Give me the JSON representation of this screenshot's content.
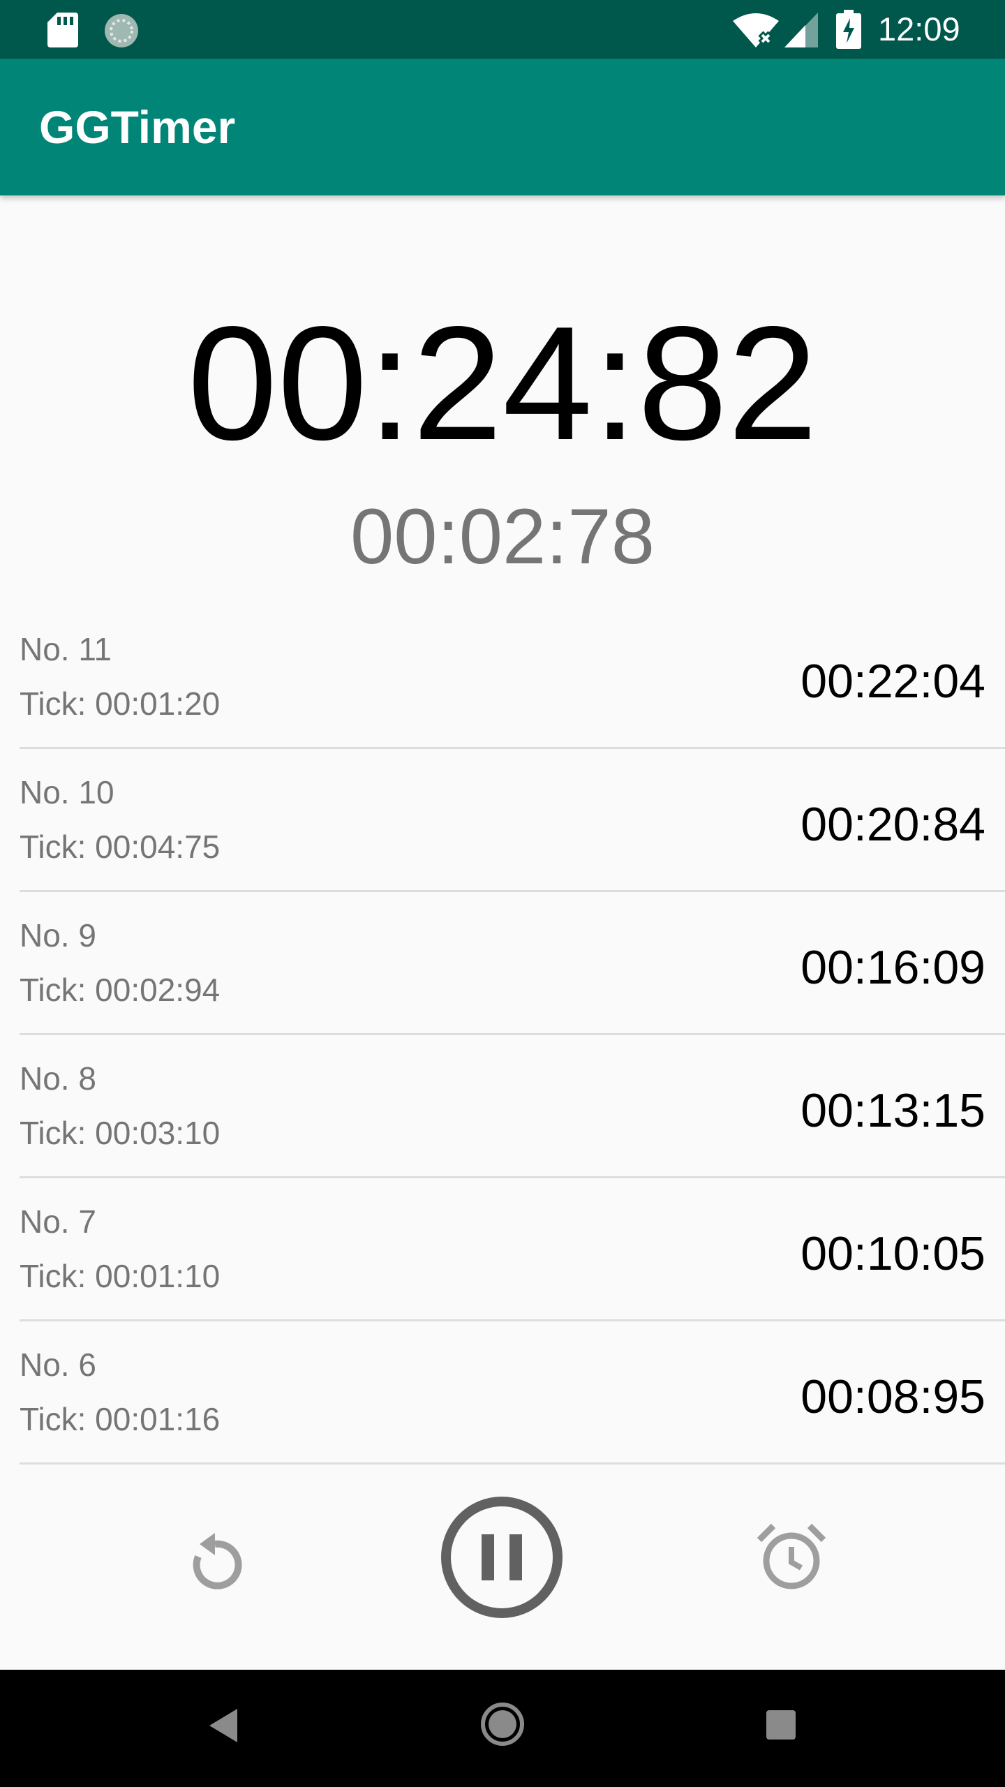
{
  "status_bar": {
    "time": "12:09",
    "icons": [
      "sd-card-icon",
      "sync-icon",
      "wifi-off-icon",
      "cell-signal-icon",
      "battery-charging-icon"
    ]
  },
  "app_bar": {
    "title": "GGTimer",
    "color": "#008577"
  },
  "timer": {
    "total": "00:24:82",
    "current_lap": "00:02:78"
  },
  "laps": [
    {
      "number": "No. 11",
      "tick": "Tick: 00:01:20",
      "total": "00:22:04"
    },
    {
      "number": "No. 10",
      "tick": "Tick: 00:04:75",
      "total": "00:20:84"
    },
    {
      "number": "No. 9",
      "tick": "Tick: 00:02:94",
      "total": "00:16:09"
    },
    {
      "number": "No. 8",
      "tick": "Tick: 00:03:10",
      "total": "00:13:15"
    },
    {
      "number": "No. 7",
      "tick": "Tick: 00:01:10",
      "total": "00:10:05"
    },
    {
      "number": "No. 6",
      "tick": "Tick: 00:01:16",
      "total": "00:08:95"
    }
  ],
  "controls": {
    "icons": [
      "reset-icon",
      "pause-icon",
      "alarm-icon"
    ]
  },
  "nav_bar": {
    "icons": [
      "back-icon",
      "home-icon",
      "recents-icon"
    ]
  }
}
